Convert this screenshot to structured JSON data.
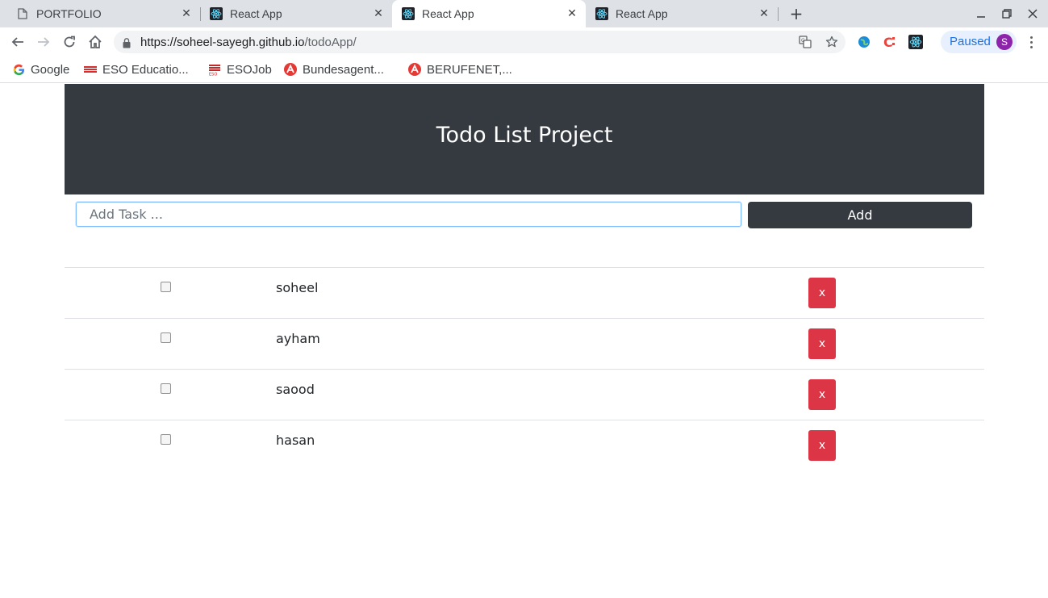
{
  "browser": {
    "tabs": [
      {
        "title": "PORTFOLIO",
        "icon": "document-icon",
        "active": false
      },
      {
        "title": "React App",
        "icon": "react-icon",
        "active": false
      },
      {
        "title": "React App",
        "icon": "react-icon",
        "active": true
      },
      {
        "title": "React App",
        "icon": "react-icon",
        "active": false
      }
    ],
    "url_host": "https://soheel-sayegh.github.io",
    "url_path": "/todoApp/",
    "profile_status": "Paused",
    "profile_initial": "S",
    "bookmarks": [
      {
        "label": "Google",
        "icon": "google-icon"
      },
      {
        "label": "ESO Educatio...",
        "icon": "eso-icon"
      },
      {
        "label": "ESOJob",
        "icon": "esojob-icon"
      },
      {
        "label": "Bundesagent...",
        "icon": "arbeitsagentur-icon"
      },
      {
        "label": "BERUFENET,...",
        "icon": "arbeitsagentur-icon"
      }
    ],
    "colors": {
      "accent": "#1a73e8",
      "avatar": "#8e24aa",
      "react": "#61dafb"
    }
  },
  "app": {
    "title": "Todo List Project",
    "input_placeholder": "Add Task ...",
    "add_label": "Add",
    "delete_label": "x",
    "todos": [
      {
        "text": "soheel",
        "done": false
      },
      {
        "text": "ayham",
        "done": false
      },
      {
        "text": "saood",
        "done": false
      },
      {
        "text": "hasan",
        "done": false
      }
    ],
    "colors": {
      "header": "#343a40",
      "delete": "#dc3545"
    }
  }
}
